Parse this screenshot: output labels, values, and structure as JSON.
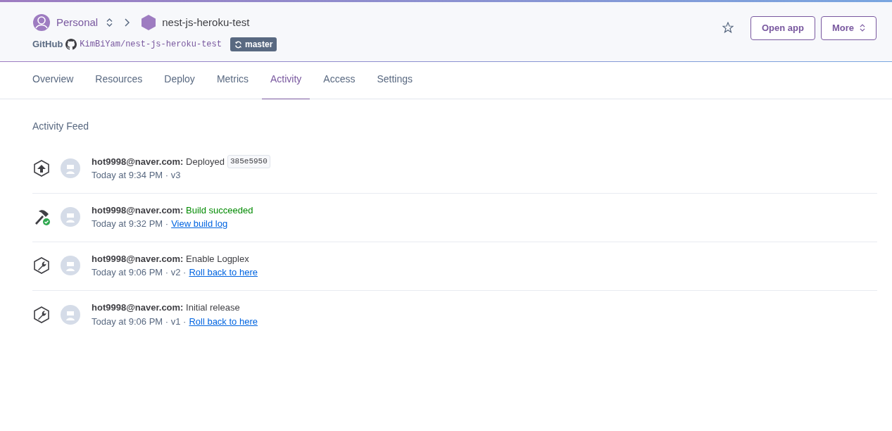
{
  "header": {
    "account": "Personal",
    "app": "nest-js-heroku-test",
    "source_label": "GitHub",
    "repo": "KimBiYam/nest-js-heroku-test",
    "branch": "master",
    "starred": false,
    "buttons": [
      "Open app",
      "More"
    ]
  },
  "tabs": [
    {
      "label": "Overview",
      "selected": false
    },
    {
      "label": "Resources",
      "selected": false
    },
    {
      "label": "Deploy",
      "selected": false
    },
    {
      "label": "Metrics",
      "selected": false
    },
    {
      "label": "Activity",
      "selected": true
    },
    {
      "label": "Access",
      "selected": false
    },
    {
      "label": "Settings",
      "selected": false
    }
  ],
  "feed_title": "Activity Feed",
  "activities": [
    {
      "kind": "deploy",
      "user": "hot9998@naver.com:",
      "action": "Deployed",
      "success": false,
      "commit": "385e5950",
      "meta": "Today at 9:34 PM · v3"
    },
    {
      "kind": "build",
      "user": "hot9998@naver.com:",
      "action": "Build succeeded",
      "success": true,
      "meta": "Today at 9:32 PM ·",
      "link": "View build log"
    },
    {
      "kind": "release",
      "user": "hot9998@naver.com:",
      "action": "Enable Logplex",
      "success": false,
      "meta": "Today at 9:06 PM · v2 ·",
      "link": "Roll back to here"
    },
    {
      "kind": "release",
      "user": "hot9998@naver.com:",
      "action": "Initial release",
      "success": false,
      "meta": "Today at 9:06 PM · v1 ·",
      "link": "Roll back to here"
    }
  ]
}
